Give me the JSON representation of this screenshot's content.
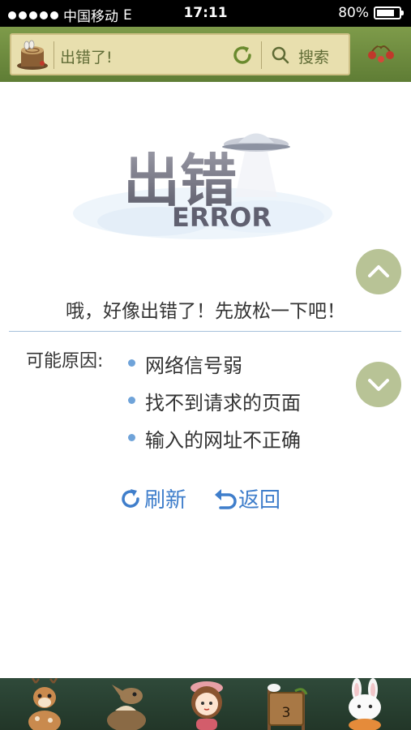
{
  "status_bar": {
    "carrier": "中国移动",
    "network": "E",
    "time": "17:11",
    "battery": "80%",
    "battery_level": 0.8
  },
  "toolbar": {
    "page_title": "出错了!",
    "search_label": "搜索"
  },
  "error": {
    "art_title": "出错",
    "art_subtitle": "ERROR",
    "message": "哦，好像出错了！先放松一下吧！",
    "reasons_label": "可能原因:",
    "reasons": [
      "网络信号弱",
      "找不到请求的页面",
      "输入的网址不正确"
    ]
  },
  "actions": {
    "refresh": "刷新",
    "back": "返回"
  },
  "bottom_bar": {
    "bookmark_count": "3"
  },
  "colors": {
    "toolbar_green": "#6f8c41",
    "url_box": "#e8dfae",
    "link_blue": "#3f7ecb",
    "scroll_button": "#b8c396",
    "bottom_bar": "#2a4232"
  }
}
